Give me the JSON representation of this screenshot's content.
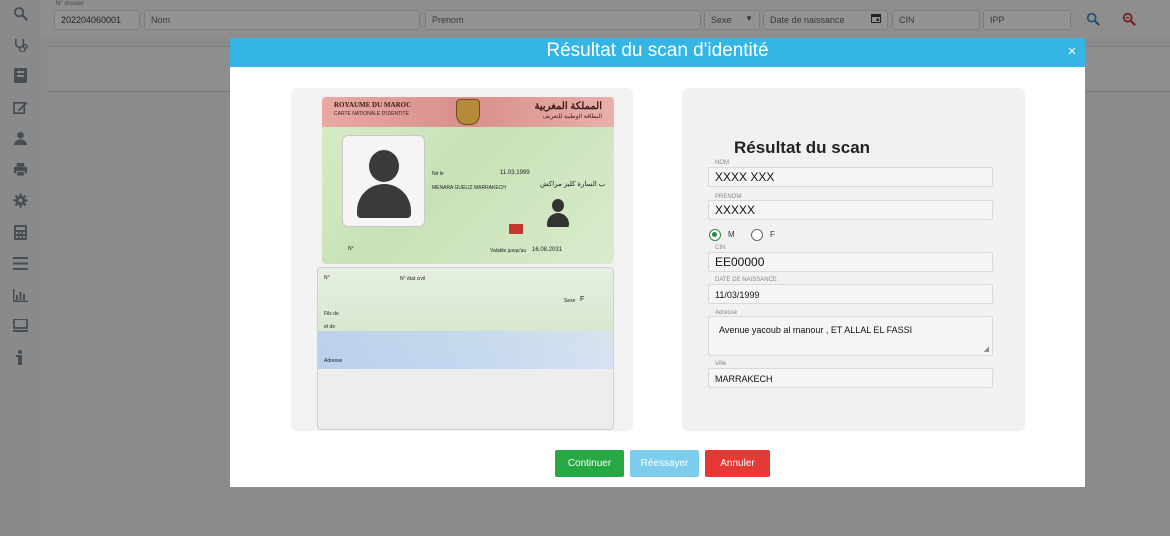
{
  "topbar": {
    "dossier_label": "N° dossier",
    "dossier_value": "202204060001",
    "nom_placeholder": "Nom",
    "prenom_placeholder": "Prenom",
    "sexe_placeholder": "Sexe",
    "naissance_placeholder": "Date de naissance",
    "cin_placeholder": "CIN",
    "ipp_placeholder": "IPP"
  },
  "modal": {
    "title": "Résultat du scan d'identité",
    "close_label": "×",
    "scan_title": "Résultat du scan",
    "fields": {
      "nom_label": "NOM",
      "nom_value": "XXXX XXX",
      "prenom_label": "PRENOM",
      "prenom_value": "XXXXX",
      "sexe_m_label": "M",
      "sexe_f_label": "F",
      "sexe_selected": "M",
      "cin_label": "CIN",
      "cin_value": "EE00000",
      "naissance_label": "DATE DE NAISSANCE",
      "naissance_value": "11/03/1999",
      "adresse_label": "Adresse",
      "adresse_value": "Avenue yacoub al manour , ET ALLAL EL FASSI",
      "ville_label": "Ville",
      "ville_value": "MARRAKECH"
    },
    "buttons": {
      "continue": "Continuer",
      "retry": "Réessayer",
      "cancel": "Annuler"
    }
  },
  "id_card": {
    "kingdom_fr": "ROYAUME DU MAROC",
    "kingdom_ar": "المملكة المغربية",
    "card_fr": "CARTE NATIONALE D'IDENTITE",
    "card_ar": "البطاقة الوطنية للتعريف",
    "birth_date": "11.03.1999",
    "birth_label": "Né le",
    "birth_place": "MENARA GUELIZ MARRAKECH",
    "birth_place_ar": "ب السارة كليز مراكش",
    "expiry_label": "Valable jusqu'au",
    "expiry_date": "16.08.2031",
    "no_label": "N°",
    "back_sex_label": "Sexe",
    "back_sex_value": "F",
    "back_father_label": "Fils de",
    "back_mother_label": "et de",
    "back_address_label": "Adresse",
    "back_civil_label": "N° état civil"
  },
  "colors": {
    "header_blue": "#35b5e5",
    "continue_green": "#28a745",
    "retry_blue": "#7dcdec",
    "cancel_red": "#e53935"
  },
  "sidebar_icons": [
    "search-icon",
    "stethoscope-icon",
    "patient-file-icon",
    "edit-icon",
    "user-icon",
    "printer-icon",
    "gear-icon",
    "calculator-icon",
    "list-icon",
    "bar-chart-icon",
    "monitor-icon",
    "info-icon"
  ]
}
